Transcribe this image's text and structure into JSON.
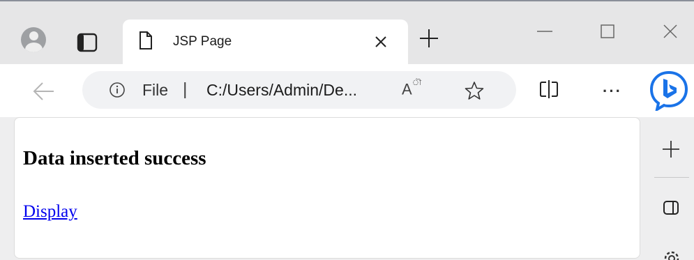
{
  "tab": {
    "title": "JSP Page"
  },
  "address_bar": {
    "scheme_label": "File",
    "separator": "|",
    "url": "C:/Users/Admin/De..."
  },
  "toolbar": {
    "read_aloud_label": "A",
    "read_aloud_mark": "ৗ",
    "more_label": "···"
  },
  "page": {
    "heading": "Data inserted success",
    "link_label": "Display"
  },
  "colors": {
    "link": "#0000ee",
    "bing_blue": "#1a73e8",
    "tab_bg": "#ffffff",
    "frame_bg": "#e6e6e7"
  },
  "icons": [
    "profile-avatar-icon",
    "tab-actions-icon",
    "page-icon",
    "close-icon",
    "new-tab-icon",
    "minimize-icon",
    "maximize-icon",
    "window-close-icon",
    "back-arrow-icon",
    "info-icon",
    "read-aloud-icon",
    "favorite-star-icon",
    "split-screen-icon",
    "bing-copilot-icon",
    "add-icon",
    "sidebar-panel-icon",
    "settings-gear-icon"
  ]
}
